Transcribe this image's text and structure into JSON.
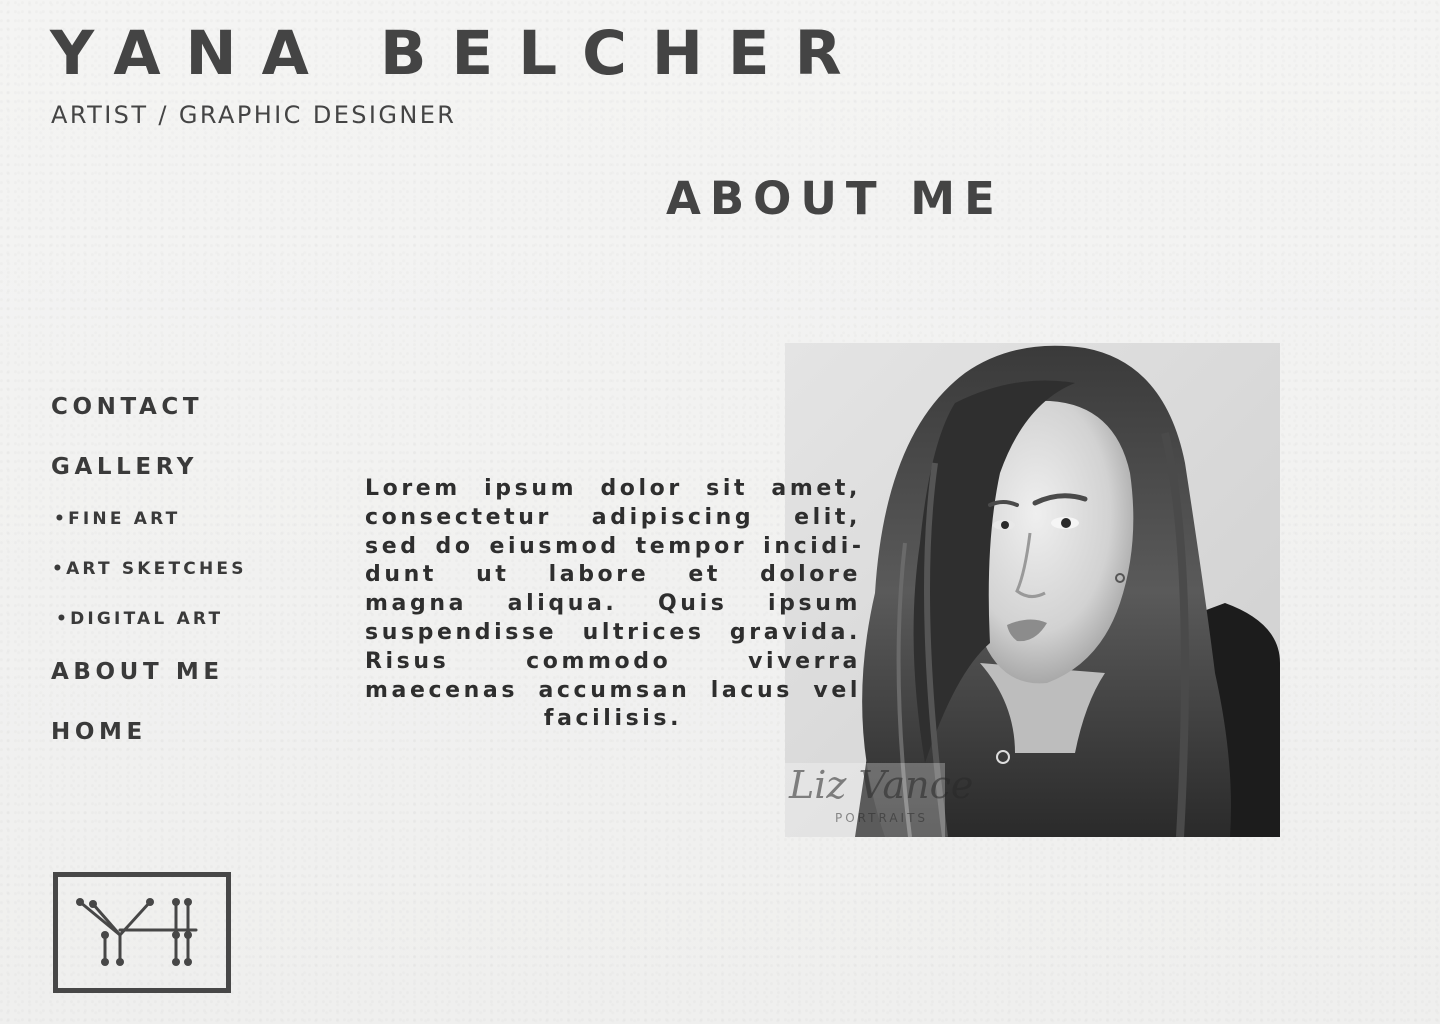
{
  "header": {
    "title": "YANA BELCHER",
    "subtitle": "ARTIST / GRAPHIC DESIGNER"
  },
  "page": {
    "heading": "ABOUT ME"
  },
  "nav": {
    "contact": "CONTACT",
    "gallery": "GALLERY",
    "fine_art": "•FINE ART",
    "art_sketches": "•ART SKETCHES",
    "digital_art": "•DIGITAL ART",
    "about_me": "ABOUT ME",
    "home": "HOME"
  },
  "bio": {
    "text": "Lorem ipsum dolor sit amet, consectetur adipiscing elit, sed do eiusmod tempor incidi­dunt ut labore et dolore magna aliqua. Quis ipsum suspendisse ultrices gravida. Risus commo­do viverra maecenas ac­cumsan lacus vel facilisis."
  },
  "portrait": {
    "watermark_script": "Liz Vance",
    "watermark_caption": "PORTRAITS"
  },
  "logo": {
    "monogram": "YH"
  },
  "colors": {
    "background": "#f2f2f1",
    "text": "#444444",
    "logo_stroke": "#474747"
  }
}
